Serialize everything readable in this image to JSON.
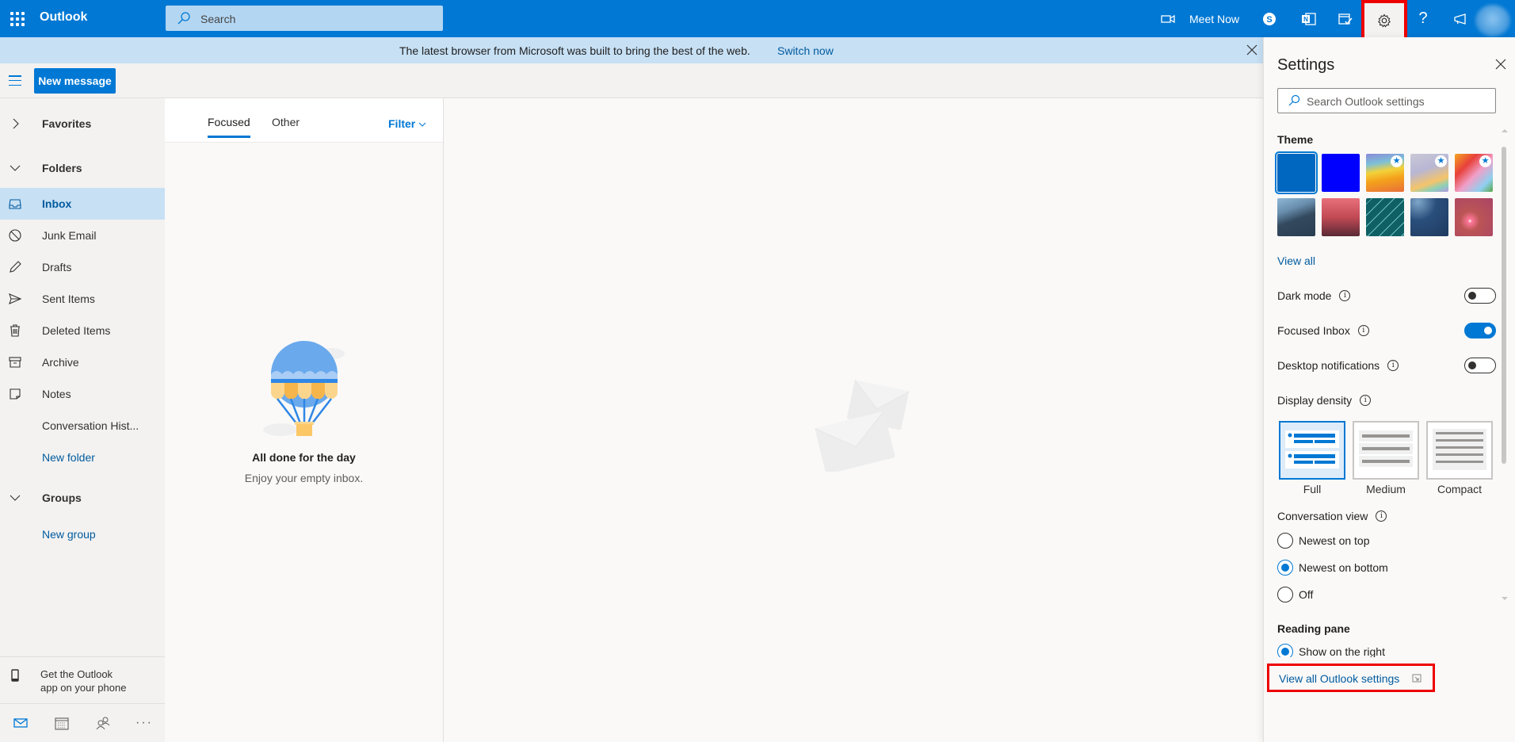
{
  "topbar": {
    "app_title": "Outlook",
    "search_placeholder": "Search",
    "meet_now_label": "Meet Now",
    "icons": [
      "app-launcher-icon",
      "video-camera-icon",
      "skype-icon",
      "onenote-icon",
      "my-day-icon",
      "gear-icon",
      "help-icon",
      "feedback-megaphone-icon",
      "avatar"
    ],
    "accent_color": "#0078d4"
  },
  "banner": {
    "message": "The latest browser from Microsoft was built to bring the best of the web.",
    "link": "Switch now"
  },
  "commandbar": {
    "new_message_label": "New message"
  },
  "leftnav": {
    "favorites": "Favorites",
    "folders": "Folders",
    "items": [
      {
        "label": "Inbox",
        "icon": "inbox-icon",
        "selected": true
      },
      {
        "label": "Junk Email",
        "icon": "block-icon"
      },
      {
        "label": "Drafts",
        "icon": "pencil-icon"
      },
      {
        "label": "Sent Items",
        "icon": "send-icon"
      },
      {
        "label": "Deleted Items",
        "icon": "trash-icon"
      },
      {
        "label": "Archive",
        "icon": "archive-icon"
      },
      {
        "label": "Notes",
        "icon": "note-icon"
      },
      {
        "label": "Conversation Hist..."
      }
    ],
    "new_folder": "New folder",
    "groups": "Groups",
    "new_group": "New group",
    "get_app_line1": "Get the Outlook",
    "get_app_line2": "app on your phone"
  },
  "messagelist": {
    "tabs": [
      {
        "label": "Focused",
        "active": true
      },
      {
        "label": "Other",
        "active": false
      }
    ],
    "filter_label": "Filter",
    "empty_title": "All done for the day",
    "empty_subtitle": "Enjoy your empty inbox."
  },
  "settings": {
    "title": "Settings",
    "search_placeholder": "Search Outlook settings",
    "theme_heading": "Theme",
    "theme_selected_index": 0,
    "view_all": "View all",
    "dark_mode": {
      "label": "Dark mode",
      "on": false
    },
    "focused_inbox": {
      "label": "Focused Inbox",
      "on": true
    },
    "desktop_notifications": {
      "label": "Desktop notifications",
      "on": false
    },
    "display_density": {
      "label": "Display density",
      "options": [
        "Full",
        "Medium",
        "Compact"
      ],
      "selected": "Full"
    },
    "conversation_view": {
      "label": "Conversation view",
      "options": [
        "Newest on top",
        "Newest on bottom",
        "Off"
      ],
      "selected": "Newest on bottom"
    },
    "reading_pane": {
      "label": "Reading pane",
      "options": [
        "Show on the right"
      ],
      "selected": "Show on the right"
    },
    "view_all_settings": "View all Outlook settings"
  }
}
